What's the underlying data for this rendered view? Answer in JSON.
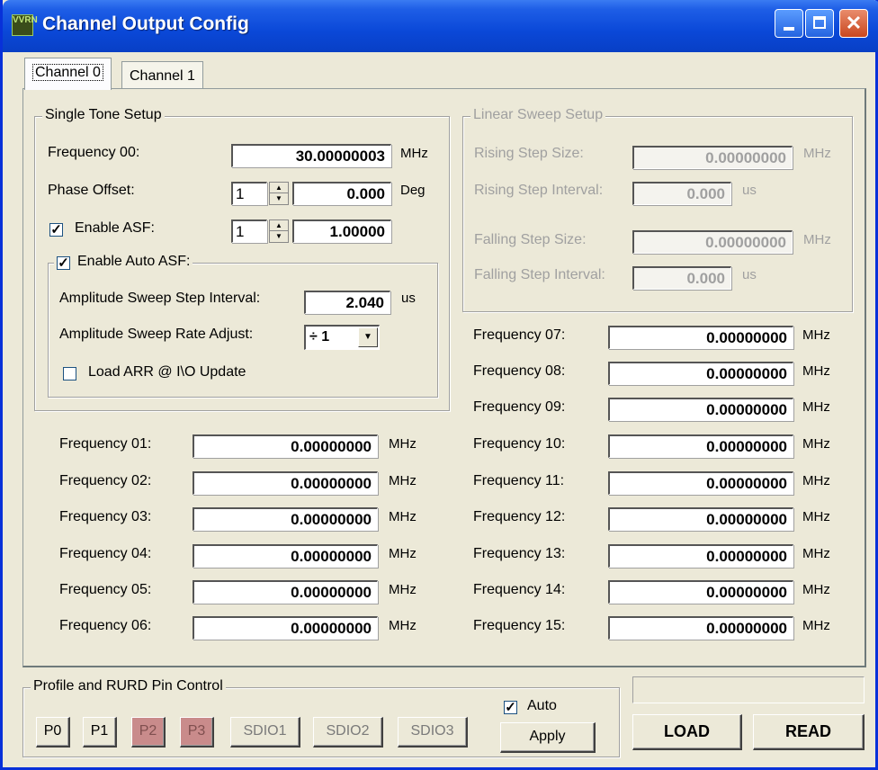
{
  "window": {
    "title": "Channel Output Config",
    "icon_text": "VVRN",
    "close_glyph": "✕"
  },
  "tabs": [
    {
      "label": "Channel 0"
    },
    {
      "label": "Channel 1"
    }
  ],
  "single_tone": {
    "label": "Single Tone Setup",
    "frequency_label": "Frequency 00:",
    "frequency_value": "30.00000003",
    "frequency_unit": "MHz",
    "phase_label": "Phase Offset:",
    "phase_spin": "1",
    "phase_value": "0.000",
    "phase_unit": "Deg",
    "asf_label": "Enable ASF:",
    "asf_checked": "✓",
    "asf_spin": "1",
    "asf_value": "1.00000",
    "auto_asf": {
      "label": "Enable Auto ASF:",
      "checked": "✓",
      "step_interval_label": "Amplitude Sweep Step Interval:",
      "step_interval_value": "2.040",
      "step_interval_unit": "us",
      "rate_adjust_label": "Amplitude Sweep Rate Adjust:",
      "rate_adjust_value": "÷ 1",
      "load_arr_label": "Load ARR @ I\\O Update"
    }
  },
  "linear_sweep": {
    "label": "Linear Sweep Setup",
    "rising_step_size_label": "Rising Step Size:",
    "rising_step_size_value": "0.00000000",
    "rising_step_size_unit": "MHz",
    "rising_step_interval_label": "Rising Step Interval:",
    "rising_step_interval_value": "0.000",
    "rising_step_interval_unit": "us",
    "falling_step_size_label": "Falling Step Size:",
    "falling_step_size_value": "0.00000000",
    "falling_step_size_unit": "MHz",
    "falling_step_interval_label": "Falling Step Interval:",
    "falling_step_interval_value": "0.000",
    "falling_step_interval_unit": "us"
  },
  "frequencies_left": [
    {
      "label": "Frequency 01:",
      "value": "0.00000000",
      "unit": "MHz"
    },
    {
      "label": "Frequency 02:",
      "value": "0.00000000",
      "unit": "MHz"
    },
    {
      "label": "Frequency 03:",
      "value": "0.00000000",
      "unit": "MHz"
    },
    {
      "label": "Frequency 04:",
      "value": "0.00000000",
      "unit": "MHz"
    },
    {
      "label": "Frequency 05:",
      "value": "0.00000000",
      "unit": "MHz"
    },
    {
      "label": "Frequency 06:",
      "value": "0.00000000",
      "unit": "MHz"
    }
  ],
  "frequencies_right": [
    {
      "label": "Frequency 07:",
      "value": "0.00000000",
      "unit": "MHz"
    },
    {
      "label": "Frequency 08:",
      "value": "0.00000000",
      "unit": "MHz"
    },
    {
      "label": "Frequency 09:",
      "value": "0.00000000",
      "unit": "MHz"
    },
    {
      "label": "Frequency 10:",
      "value": "0.00000000",
      "unit": "MHz"
    },
    {
      "label": "Frequency 11:",
      "value": "0.00000000",
      "unit": "MHz"
    },
    {
      "label": "Frequency 12:",
      "value": "0.00000000",
      "unit": "MHz"
    },
    {
      "label": "Frequency 13:",
      "value": "0.00000000",
      "unit": "MHz"
    },
    {
      "label": "Frequency 14:",
      "value": "0.00000000",
      "unit": "MHz"
    },
    {
      "label": "Frequency 15:",
      "value": "0.00000000",
      "unit": "MHz"
    }
  ],
  "profile_control": {
    "label": "Profile and RURD Pin Control",
    "buttons": [
      "P0",
      "P1",
      "P2",
      "P3",
      "SDIO1",
      "SDIO2",
      "SDIO3"
    ],
    "pressed_color": "#c98b8b",
    "auto_label": "Auto",
    "auto_checked": "✓",
    "apply_label": "Apply"
  },
  "actions": {
    "load_label": "LOAD",
    "read_label": "READ"
  }
}
